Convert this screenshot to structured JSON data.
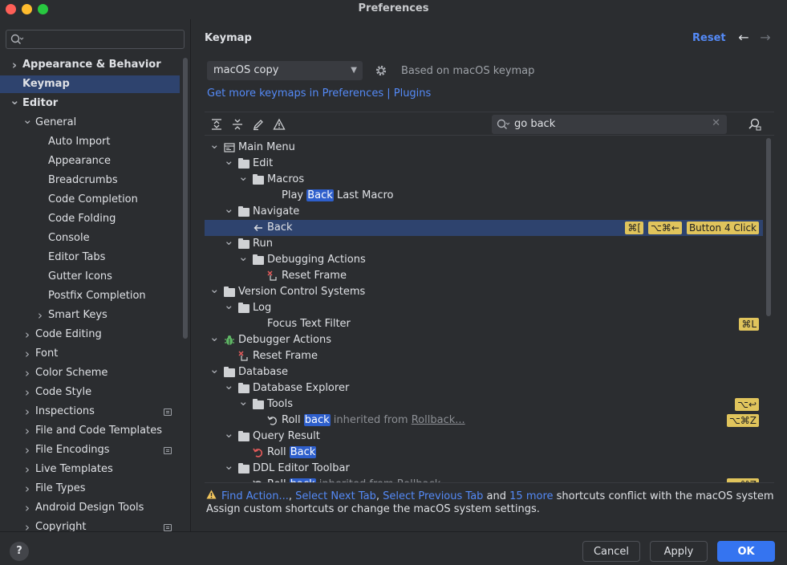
{
  "window": {
    "title": "Preferences"
  },
  "sidebar": {
    "search_placeholder": "",
    "items": [
      {
        "label": "Appearance & Behavior",
        "level": 0,
        "arrow": "right",
        "bold": true,
        "selected": false,
        "proj": false
      },
      {
        "label": "Keymap",
        "level": 0,
        "arrow": "",
        "bold": true,
        "selected": true,
        "proj": false
      },
      {
        "label": "Editor",
        "level": 0,
        "arrow": "down",
        "bold": true,
        "selected": false,
        "proj": false
      },
      {
        "label": "General",
        "level": 1,
        "arrow": "down",
        "bold": false,
        "selected": false,
        "proj": false
      },
      {
        "label": "Auto Import",
        "level": 2,
        "arrow": "",
        "bold": false,
        "selected": false,
        "proj": false
      },
      {
        "label": "Appearance",
        "level": 2,
        "arrow": "",
        "bold": false,
        "selected": false,
        "proj": false
      },
      {
        "label": "Breadcrumbs",
        "level": 2,
        "arrow": "",
        "bold": false,
        "selected": false,
        "proj": false
      },
      {
        "label": "Code Completion",
        "level": 2,
        "arrow": "",
        "bold": false,
        "selected": false,
        "proj": false
      },
      {
        "label": "Code Folding",
        "level": 2,
        "arrow": "",
        "bold": false,
        "selected": false,
        "proj": false
      },
      {
        "label": "Console",
        "level": 2,
        "arrow": "",
        "bold": false,
        "selected": false,
        "proj": false
      },
      {
        "label": "Editor Tabs",
        "level": 2,
        "arrow": "",
        "bold": false,
        "selected": false,
        "proj": false
      },
      {
        "label": "Gutter Icons",
        "level": 2,
        "arrow": "",
        "bold": false,
        "selected": false,
        "proj": false
      },
      {
        "label": "Postfix Completion",
        "level": 2,
        "arrow": "",
        "bold": false,
        "selected": false,
        "proj": false
      },
      {
        "label": "Smart Keys",
        "level": 2,
        "arrow": "right",
        "bold": false,
        "selected": false,
        "proj": false
      },
      {
        "label": "Code Editing",
        "level": 1,
        "arrow": "right",
        "bold": false,
        "selected": false,
        "proj": false
      },
      {
        "label": "Font",
        "level": 1,
        "arrow": "right",
        "bold": false,
        "selected": false,
        "proj": false
      },
      {
        "label": "Color Scheme",
        "level": 1,
        "arrow": "right",
        "bold": false,
        "selected": false,
        "proj": false
      },
      {
        "label": "Code Style",
        "level": 1,
        "arrow": "right",
        "bold": false,
        "selected": false,
        "proj": false
      },
      {
        "label": "Inspections",
        "level": 1,
        "arrow": "right",
        "bold": false,
        "selected": false,
        "proj": true
      },
      {
        "label": "File and Code Templates",
        "level": 1,
        "arrow": "right",
        "bold": false,
        "selected": false,
        "proj": false
      },
      {
        "label": "File Encodings",
        "level": 1,
        "arrow": "right",
        "bold": false,
        "selected": false,
        "proj": true
      },
      {
        "label": "Live Templates",
        "level": 1,
        "arrow": "right",
        "bold": false,
        "selected": false,
        "proj": false
      },
      {
        "label": "File Types",
        "level": 1,
        "arrow": "right",
        "bold": false,
        "selected": false,
        "proj": false
      },
      {
        "label": "Android Design Tools",
        "level": 1,
        "arrow": "right",
        "bold": false,
        "selected": false,
        "proj": false
      },
      {
        "label": "Copyright",
        "level": 1,
        "arrow": "right",
        "bold": false,
        "selected": false,
        "proj": true
      }
    ]
  },
  "header": {
    "breadcrumb": "Keymap",
    "reset_label": "Reset",
    "back_icon": "arrow-left-icon",
    "forward_icon": "arrow-right-icon"
  },
  "keymap": {
    "selected": "macOS copy",
    "based_on": "Based on macOS keymap",
    "get_more": "Get more keymaps in Preferences | Plugins"
  },
  "search": {
    "value": "go back",
    "placeholder": ""
  },
  "tree": [
    {
      "level": 0,
      "arrow": "down",
      "icon": "main-menu",
      "parts": [
        {
          "t": "Main Menu"
        }
      ],
      "keys": []
    },
    {
      "level": 1,
      "arrow": "down",
      "icon": "folder",
      "parts": [
        {
          "t": "Edit"
        }
      ],
      "keys": []
    },
    {
      "level": 2,
      "arrow": "down",
      "icon": "folder",
      "parts": [
        {
          "t": "Macros"
        }
      ],
      "keys": []
    },
    {
      "level": 3,
      "arrow": "",
      "icon": "",
      "parts": [
        {
          "t": "Play "
        },
        {
          "t": "Back",
          "hl": true
        },
        {
          "t": " Last Macro"
        }
      ],
      "keys": []
    },
    {
      "level": 1,
      "arrow": "down",
      "icon": "folder",
      "parts": [
        {
          "t": "Navigate"
        }
      ],
      "keys": []
    },
    {
      "level": 2,
      "arrow": "",
      "icon": "back",
      "parts": [
        {
          "t": "Back"
        }
      ],
      "keys": [
        "⌘[",
        "⌥⌘←",
        "Button 4 Click"
      ],
      "selected": true
    },
    {
      "level": 1,
      "arrow": "down",
      "icon": "folder",
      "parts": [
        {
          "t": "Run"
        }
      ],
      "keys": []
    },
    {
      "level": 2,
      "arrow": "down",
      "icon": "folder",
      "parts": [
        {
          "t": "Debugging Actions"
        }
      ],
      "keys": []
    },
    {
      "level": 3,
      "arrow": "",
      "icon": "reset-frame",
      "parts": [
        {
          "t": "Reset Frame"
        }
      ],
      "keys": []
    },
    {
      "level": 0,
      "arrow": "down",
      "icon": "folder",
      "parts": [
        {
          "t": "Version Control Systems"
        }
      ],
      "keys": []
    },
    {
      "level": 1,
      "arrow": "down",
      "icon": "folder",
      "parts": [
        {
          "t": "Log"
        }
      ],
      "keys": []
    },
    {
      "level": 2,
      "arrow": "",
      "icon": "",
      "parts": [
        {
          "t": "Focus Text Filter"
        }
      ],
      "keys": [
        "⌘L"
      ]
    },
    {
      "level": 0,
      "arrow": "down",
      "icon": "debugger",
      "parts": [
        {
          "t": "Debugger Actions"
        }
      ],
      "keys": []
    },
    {
      "level": 1,
      "arrow": "",
      "icon": "reset-frame",
      "parts": [
        {
          "t": "Reset Frame"
        }
      ],
      "keys": []
    },
    {
      "level": 0,
      "arrow": "down",
      "icon": "folder",
      "parts": [
        {
          "t": "Database"
        }
      ],
      "keys": []
    },
    {
      "level": 1,
      "arrow": "down",
      "icon": "folder",
      "parts": [
        {
          "t": "Database Explorer"
        }
      ],
      "keys": []
    },
    {
      "level": 2,
      "arrow": "down",
      "icon": "folder",
      "parts": [
        {
          "t": "Tools"
        }
      ],
      "keys": [
        "⌥↩"
      ]
    },
    {
      "level": 3,
      "arrow": "",
      "icon": "rollback",
      "parts": [
        {
          "t": "Roll "
        },
        {
          "t": "back",
          "hl": true
        },
        {
          "t": " inherited from ",
          "dim": true
        },
        {
          "t": "Rollback...",
          "link": true
        }
      ],
      "keys": [
        "⌥⌘Z"
      ]
    },
    {
      "level": 1,
      "arrow": "down",
      "icon": "folder",
      "parts": [
        {
          "t": "Query Result"
        }
      ],
      "keys": []
    },
    {
      "level": 2,
      "arrow": "",
      "icon": "rollback-red",
      "parts": [
        {
          "t": "Roll "
        },
        {
          "t": "Back",
          "hl": true
        }
      ],
      "keys": []
    },
    {
      "level": 1,
      "arrow": "down",
      "icon": "folder",
      "parts": [
        {
          "t": "DDL Editor Toolbar"
        }
      ],
      "keys": []
    },
    {
      "level": 2,
      "arrow": "",
      "icon": "rollback",
      "parts": [
        {
          "t": "Roll "
        },
        {
          "t": "back",
          "hl": true
        },
        {
          "t": " inherited from Rollback",
          "dim": true
        }
      ],
      "keys": [
        "⌥⌘Z"
      ]
    }
  ],
  "warning": {
    "links": [
      "Find Action...",
      "Select Next Tab",
      "Select Previous Tab",
      "15 more"
    ],
    "sep1": ", ",
    "sep2": ", ",
    "and": " and ",
    "tail": " shortcuts conflict with the macOS system short",
    "line2": "Assign custom shortcuts or change the macOS system settings."
  },
  "footer": {
    "help": "?",
    "cancel": "Cancel",
    "apply": "Apply",
    "ok": "OK"
  },
  "colors": {
    "accent": "#548af7",
    "selection": "#2e436e",
    "key_badge": "#e0c45c",
    "ok_button": "#3574f0"
  }
}
